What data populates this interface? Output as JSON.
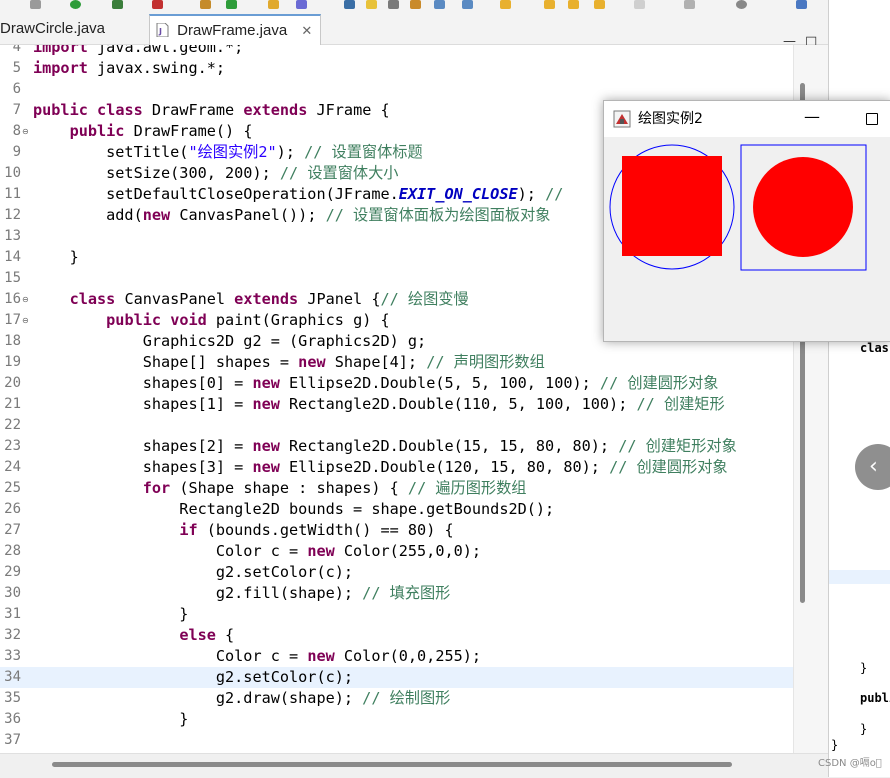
{
  "tabs": [
    {
      "label": "DrawCircle.java",
      "active": false
    },
    {
      "label": "DrawFrame.java",
      "active": true
    }
  ],
  "tab_close_glyph": "✕",
  "window_controls": {
    "minimize": "—",
    "restore": "□"
  },
  "editor": {
    "lines": [
      {
        "num": "4",
        "code": "import java.awt.geom.*;"
      },
      {
        "num": "5",
        "code": "import javax.swing.*;"
      },
      {
        "num": "6",
        "code": ""
      },
      {
        "num": "7",
        "code": "public class DrawFrame extends JFrame {"
      },
      {
        "num": "8",
        "code": "    public DrawFrame() {",
        "fold": true
      },
      {
        "num": "9",
        "code": "        setTitle(\"绘图实例2\"); // 设置窗体标题"
      },
      {
        "num": "10",
        "code": "        setSize(300, 200); // 设置窗体大小"
      },
      {
        "num": "11",
        "code": "        setDefaultCloseOperation(JFrame.EXIT_ON_CLOSE); //"
      },
      {
        "num": "12",
        "code": "        add(new CanvasPanel()); // 设置窗体面板为绘图面板对象"
      },
      {
        "num": "13",
        "code": ""
      },
      {
        "num": "14",
        "code": "    }"
      },
      {
        "num": "15",
        "code": ""
      },
      {
        "num": "16",
        "code": "    class CanvasPanel extends JPanel {// 绘图变慢",
        "fold": true
      },
      {
        "num": "17",
        "code": "        public void paint(Graphics g) {",
        "fold": true
      },
      {
        "num": "18",
        "code": "            Graphics2D g2 = (Graphics2D) g;"
      },
      {
        "num": "19",
        "code": "            Shape[] shapes = new Shape[4]; // 声明图形数组"
      },
      {
        "num": "20",
        "code": "            shapes[0] = new Ellipse2D.Double(5, 5, 100, 100); // 创建圆形对象"
      },
      {
        "num": "21",
        "code": "            shapes[1] = new Rectangle2D.Double(110, 5, 100, 100); // 创建矩形"
      },
      {
        "num": "22",
        "code": ""
      },
      {
        "num": "23",
        "code": "            shapes[2] = new Rectangle2D.Double(15, 15, 80, 80); // 创建矩形对象"
      },
      {
        "num": "24",
        "code": "            shapes[3] = new Ellipse2D.Double(120, 15, 80, 80); // 创建圆形对象"
      },
      {
        "num": "25",
        "code": "            for (Shape shape : shapes) { // 遍历图形数组"
      },
      {
        "num": "26",
        "code": "                Rectangle2D bounds = shape.getBounds2D();"
      },
      {
        "num": "27",
        "code": "                if (bounds.getWidth() == 80) {"
      },
      {
        "num": "28",
        "code": "                    Color c = new Color(255,0,0);"
      },
      {
        "num": "29",
        "code": "                    g2.setColor(c);"
      },
      {
        "num": "30",
        "code": "                    g2.fill(shape); // 填充图形"
      },
      {
        "num": "31",
        "code": "                }"
      },
      {
        "num": "32",
        "code": "                else {"
      },
      {
        "num": "33",
        "code": "                    Color c = new Color(0,0,255);"
      },
      {
        "num": "34",
        "code": "                    g2.setColor(c);",
        "highlight": true
      },
      {
        "num": "35",
        "code": "                    g2.draw(shape); // 绘制图形"
      },
      {
        "num": "36",
        "code": "                }"
      },
      {
        "num": "37",
        "code": ""
      }
    ]
  },
  "right_panel": {
    "snippets": [
      "clas",
      "(",
      "}",
      "publi",
      "}",
      "}"
    ]
  },
  "back_glyph": "‹",
  "popup": {
    "title": "绘图实例2",
    "minimize": "—"
  },
  "watermark": "CSDN @嗝o\u0000",
  "colors": {
    "fill_red": "#ff0000",
    "stroke_blue": "#0000ff",
    "keyword": "#7f0055",
    "comment": "#3f7f5f",
    "string": "#2a00ff",
    "line_highlight": "#e8f2fe"
  }
}
